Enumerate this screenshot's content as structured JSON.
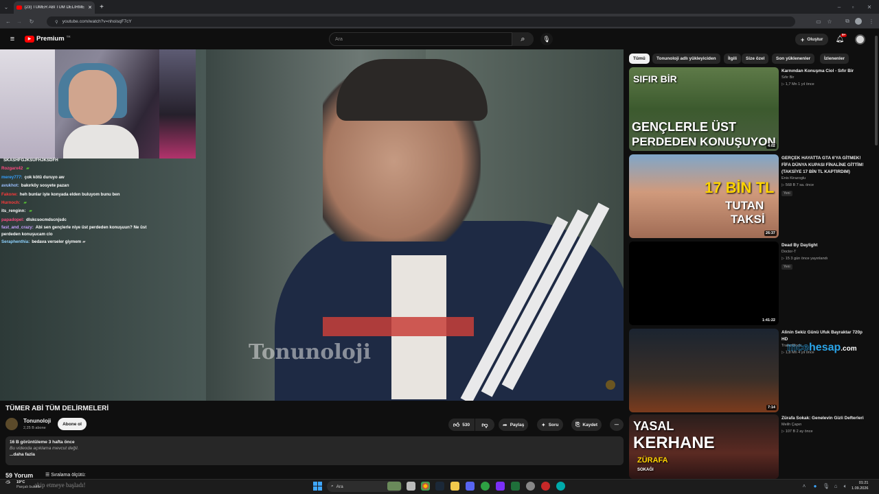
{
  "browser": {
    "tab_title": "(23) TÜMER ABİ TÜM DELİRME",
    "url": "youtube.com/watch?v=nhoisqF7cY"
  },
  "header": {
    "logo_label": "Premium",
    "logo_sup": "TR",
    "search_placeholder": "Ara",
    "create_label": "Oluştur",
    "notif_count": "9+"
  },
  "chat": [
    {
      "user": "",
      "msg": "SKASHFGJKSUFHJKSDFH",
      "color": "#9146ff"
    },
    {
      "user": "Rozgarx42",
      "msg": "",
      "color": "#ff4a80"
    },
    {
      "user": "merey777:",
      "msg": "çok kötü duruyo aw",
      "color": "#35a0ff"
    },
    {
      "user": "avukhot:",
      "msg": "bakırköy sosyete pazarı",
      "color": "#9cc0ff"
    },
    {
      "user": "Fakone:",
      "msg": "heh bunlar işte konyada elden buluyom bunu ben",
      "color": "#ff3a3a"
    },
    {
      "user": "Hurnoch:",
      "msg": "",
      "color": "#ff3a3a"
    },
    {
      "user": "its_renginn:",
      "msg": "",
      "color": "#ffffff"
    },
    {
      "user": "papadopel:",
      "msg": "dlskcsocmdscnjsdc",
      "color": "#ff4a80"
    },
    {
      "user": "fast_and_crazy:",
      "msg": "Abi sen gençlerle niye üst perdeden konuşuun? Ne üst perdeden konuşucam clo",
      "color": "#c8a0ff"
    },
    {
      "user": "Seraphenthia:",
      "msg": "bedava verseler giymem",
      "color": "#8fd3ff"
    }
  ],
  "video": {
    "watermark": "Tonunoloji",
    "title": "TÜMER ABİ TÜM DELİRMELERİ",
    "channel": "Tonunoloji",
    "subscribers": "2,25 B abone",
    "subscribe_label": "Abone ol",
    "likes": "530",
    "share_label": "Paylaş",
    "ask_label": "Soru",
    "save_label": "Kaydet",
    "desc_stats": "16 B görüntüleme  3 hafta önce",
    "desc_text": "Bu videoda açıklama mevcut değil.",
    "desc_more": "...daha fazla",
    "comments_label": "59 Yorum",
    "sort_label": "Sıralama ölçütü:"
  },
  "chips": [
    "Tümü",
    "Tonunoloji adlı yükleyiciden",
    "İlgili",
    "Size özel",
    "Son yüklenenler",
    "İzlenenler"
  ],
  "recommendations": [
    {
      "title": "Karnından Konuşma Ciol - Sıfır Bir",
      "channel": "Sıfır Bir",
      "meta": "1,7 Mn  1 yıl önce",
      "duration": "4:02",
      "badge": "",
      "thumb_text": [
        "SIFIR BİR",
        "GENÇLERLE ÜST",
        "PERDEDEN KONUŞUYON"
      ]
    },
    {
      "title": "GERÇEK HAYATTA GTA 6'YA GİTMEK! FİFA DÜNYA KUPASI FİNALİNE GİTTİM! (TAKSİYE 17 BİN TL KAPTIRDIM)",
      "channel": "Enis Kirazoglu",
      "meta": "568 B  7 sa. önce",
      "duration": "26:37",
      "badge": "Yeni",
      "thumb_text": [
        "17 BİN TL",
        "TUTAN",
        "TAKSİ"
      ]
    },
    {
      "title": "Dead By Daylight",
      "channel": "Doctor-T",
      "meta": "15  3 gün önce yayınlandı",
      "duration": "1:41:22",
      "badge": "Yeni",
      "thumb_text": []
    },
    {
      "title": "Alinin Sekiz Günü Ufuk Bayraktar 720p HD",
      "channel": "TrailerBlock",
      "meta": "1,8 Mn  4 yıl önce",
      "duration": "7:14",
      "badge": "",
      "thumb_text": []
    },
    {
      "title": "Zürafa Sokak: Genelevin Gizli Defterleri",
      "channel": "Melih Çapın",
      "meta": "107 B  2 ay önce",
      "duration": "",
      "badge": "",
      "thumb_text": [
        "YASAL",
        "KERHANE",
        "ZÜRAFA",
        "SOKAĞI"
      ]
    }
  ],
  "overlay": {
    "bottom_text": "akip etmeye başladı!",
    "site_brand_a": "mce",
    "site_brand_b": "hesap",
    "site_brand_c": ".com"
  },
  "taskbar": {
    "weather_temp": "19°C",
    "weather_desc": "Parçalı bulutlu",
    "search_label": "Ara",
    "time": "01:21",
    "date": "1.09.2026"
  }
}
